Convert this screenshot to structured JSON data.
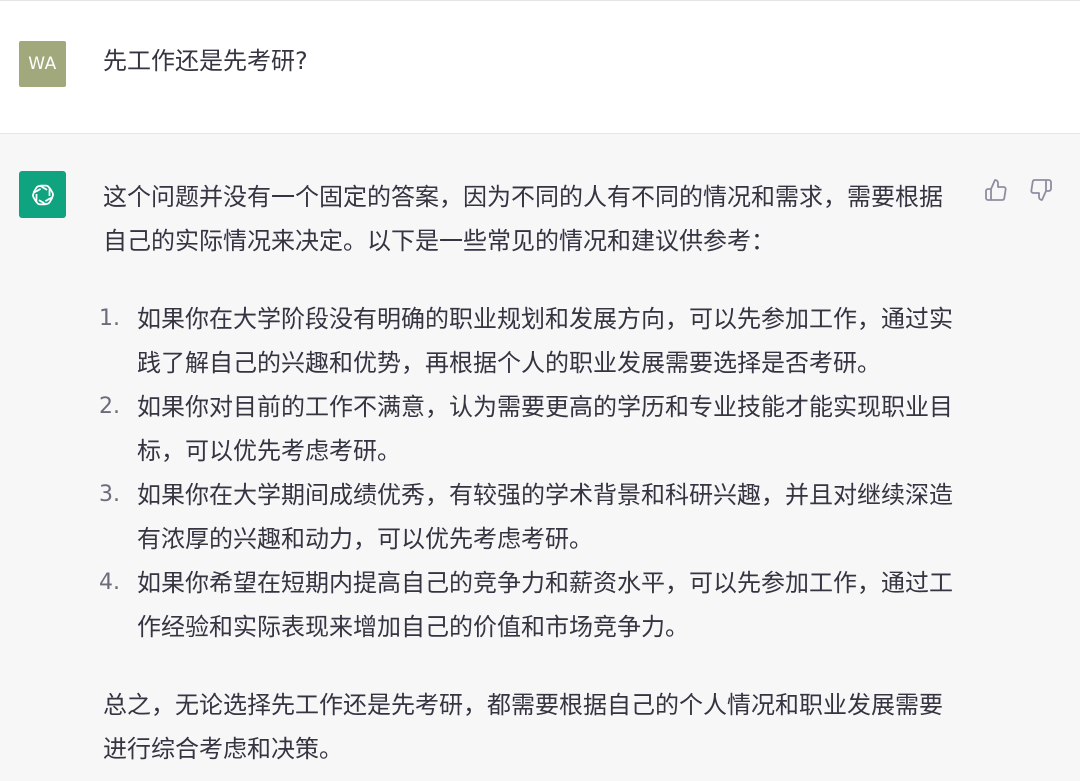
{
  "user_message": {
    "avatar_initials": "WA",
    "avatar_color": "#a1a97c",
    "text": "先工作还是先考研?"
  },
  "assistant_message": {
    "avatar_icon": "openai-logo-icon",
    "avatar_color": "#10a37f",
    "intro": "这个问题并没有一个固定的答案，因为不同的人有不同的情况和需求，需要根据自己的实际情况来决定。以下是一些常见的情况和建议供参考：",
    "items": [
      {
        "number": "1.",
        "text": "如果你在大学阶段没有明确的职业规划和发展方向，可以先参加工作，通过实践了解自己的兴趣和优势，再根据个人的职业发展需要选择是否考研。"
      },
      {
        "number": "2.",
        "text": "如果你对目前的工作不满意，认为需要更高的学历和专业技能才能实现职业目标，可以优先考虑考研。"
      },
      {
        "number": "3.",
        "text": "如果你在大学期间成绩优秀，有较强的学术背景和科研兴趣，并且对继续深造有浓厚的兴趣和动力，可以优先考虑考研。"
      },
      {
        "number": "4.",
        "text": "如果你希望在短期内提高自己的竞争力和薪资水平，可以先参加工作，通过工作经验和实际表现来增加自己的价值和市场竞争力。"
      }
    ],
    "conclusion": "总之，无论选择先工作还是先考研，都需要根据自己的个人情况和职业发展需要进行综合考虑和决策。",
    "feedback": {
      "like_icon": "thumbs-up-icon",
      "dislike_icon": "thumbs-down-icon"
    }
  }
}
